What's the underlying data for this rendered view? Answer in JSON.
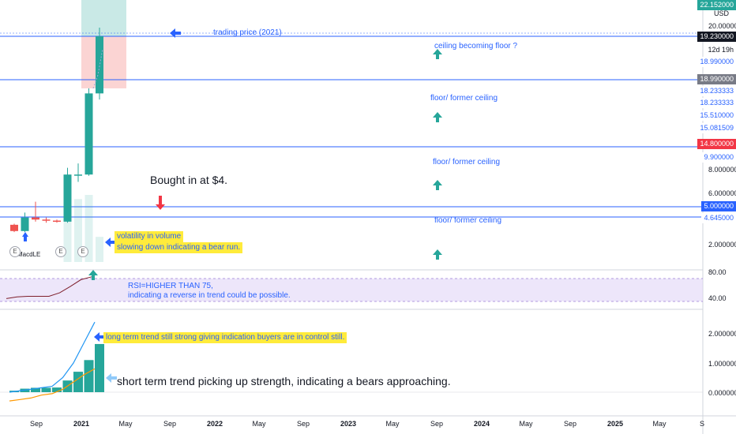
{
  "currency": "USD",
  "price_axis": {
    "plain": [
      "22.152000",
      "20.000000",
      "8.000000",
      "6.000000",
      "2.000000",
      "80.00",
      "40.00",
      "2.000000",
      "1.000000",
      "0.000000"
    ],
    "tags": [
      {
        "text": "19.230000",
        "bg": "#131722",
        "fg": "#ffffff"
      },
      {
        "text": "12d 19h",
        "bg": "#ffffff",
        "fg": "#131722"
      },
      {
        "text": "18.990000",
        "bg": "#ffffff",
        "fg": "#2962ff"
      },
      {
        "text": "18.990000",
        "bg": "#787b86",
        "fg": "#ffffff"
      },
      {
        "text": "18.233333",
        "bg": "#ffffff",
        "fg": "#2962ff"
      },
      {
        "text": "18.233333",
        "bg": "#ffffff",
        "fg": "#2962ff"
      },
      {
        "text": "15.510000",
        "bg": "#ffffff",
        "fg": "#2962ff"
      },
      {
        "text": "15.081509",
        "bg": "#ffffff",
        "fg": "#2962ff"
      },
      {
        "text": "14.800000",
        "bg": "#f23645",
        "fg": "#ffffff"
      },
      {
        "text": "9.900000",
        "bg": "#ffffff",
        "fg": "#2962ff"
      },
      {
        "text": "5.000000",
        "bg": "#2962ff",
        "fg": "#ffffff"
      },
      {
        "text": "4.645000",
        "bg": "#ffffff",
        "fg": "#2962ff"
      }
    ],
    "top_tag": "22.152000"
  },
  "x_axis": [
    "Sep",
    "2021",
    "May",
    "Sep",
    "2022",
    "May",
    "Sep",
    "2023",
    "May",
    "Sep",
    "2024",
    "May",
    "Sep",
    "2025",
    "May",
    "S"
  ],
  "annotations": {
    "trading_price": "trading price (2021)",
    "ceiling_floor": "ceiling becoming floor ?",
    "floor_former_1": "floor/ former ceiling",
    "floor_former_2": "floor/ former ceiling",
    "floor_former_3": "floor/ former ceiling",
    "bought_in": "Bought in at $4.",
    "volatility_1": "volatility in volume",
    "volatility_2": "slowing down indicating a bear run.",
    "rsi_1": "RSI=HIGHER THAN 75,",
    "rsi_2": "indicating a reverse in trend could be possible.",
    "long_term": "long term trend still strong giving indication buyers are in control still.",
    "short_term": "short term trend picking up strength, indicating  a bears approaching.",
    "macd_label": "MacdLE",
    "earnings_badge": "E"
  },
  "colors": {
    "up": "#26a69a",
    "down": "#ef5350",
    "level_line": "#2962ff",
    "rsi_band": "#e1d5f7",
    "highlight": "#ffeb3b",
    "long_line": "#2196f3",
    "short_line": "#ff9800"
  },
  "chart_data": {
    "type": "candlestick",
    "timeframe": "monthly",
    "price_levels": [
      19.23,
      18.99,
      14.8,
      5.0,
      4.645
    ],
    "candles": [
      {
        "period": "2020-05",
        "open": 3.9,
        "close": 3.3,
        "high": 4.0,
        "low": 3.2
      },
      {
        "period": "2020-06",
        "open": 3.3,
        "close": 4.6,
        "high": 4.8,
        "low": 3.2
      },
      {
        "period": "2020-07",
        "open": 4.6,
        "close": 4.4,
        "high": 5.4,
        "low": 4.2
      },
      {
        "period": "2020-08",
        "open": 4.4,
        "close": 4.3,
        "high": 4.6,
        "low": 4.1
      },
      {
        "period": "2020-09",
        "open": 4.3,
        "close": 4.2,
        "high": 4.4,
        "low": 4.1
      },
      {
        "period": "2020-10",
        "open": 4.2,
        "close": 7.6,
        "high": 8.3,
        "low": 4.1
      },
      {
        "period": "2020-11",
        "open": 7.6,
        "close": 7.6,
        "high": 9.0,
        "low": 7.0
      },
      {
        "period": "2020-12",
        "open": 7.6,
        "close": 18.2,
        "high": 18.5,
        "low": 7.5
      },
      {
        "period": "2021-01",
        "open": 18.2,
        "close": 19.23,
        "high": 20.0,
        "low": 17.5
      }
    ],
    "volume": [
      0.0,
      0.0,
      0.0,
      0.0,
      0.0,
      1.0,
      1.5,
      1.6,
      0.6
    ],
    "rsi": {
      "band": [
        40,
        80
      ],
      "values": [
        45,
        48,
        49,
        49,
        49,
        55,
        66,
        78,
        83
      ]
    },
    "macd_histogram": [
      0.05,
      0.12,
      0.15,
      0.15,
      0.16,
      0.4,
      0.7,
      1.1,
      1.65
    ],
    "long_line": [
      0.0,
      0.05,
      0.1,
      0.15,
      0.2,
      0.5,
      1.0,
      1.7,
      2.4
    ],
    "short_line": [
      -0.3,
      -0.25,
      -0.2,
      -0.1,
      -0.05,
      0.1,
      0.35,
      0.6,
      0.8
    ]
  }
}
